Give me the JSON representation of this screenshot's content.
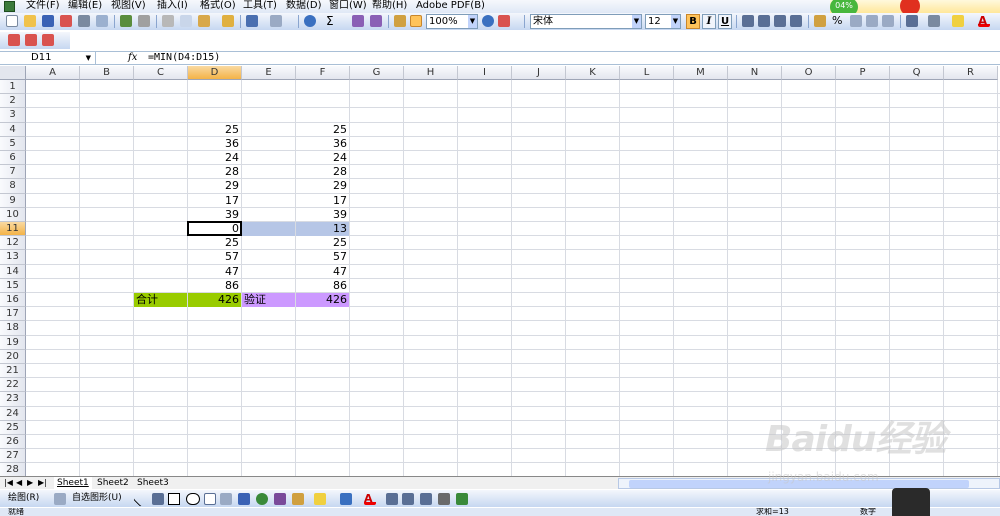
{
  "menubar": {
    "items": [
      "文件(F)",
      "编辑(E)",
      "视图(V)",
      "插入(I)",
      "格式(O)",
      "工具(T)",
      "数据(D)",
      "窗口(W)",
      "帮助(H)",
      "Adobe PDF(B)"
    ],
    "widget_badge": "04%"
  },
  "toolbar": {
    "zoom": "100%",
    "font_name": "宋体",
    "font_size": "12",
    "bold_label": "B",
    "italic_label": "I",
    "underline_label": "U",
    "percent_label": "%",
    "font_color_label": "A"
  },
  "formula_bar": {
    "name_box": "D11",
    "fx_label": "fx",
    "formula": "=MIN(D4:D15)"
  },
  "grid": {
    "columns": [
      "A",
      "B",
      "C",
      "D",
      "E",
      "F",
      "G",
      "H",
      "I",
      "J",
      "K",
      "L",
      "M",
      "N",
      "O",
      "P",
      "Q",
      "R"
    ],
    "active_column": "D",
    "active_row": "11",
    "rows": [
      "1",
      "2",
      "3",
      "4",
      "5",
      "6",
      "7",
      "8",
      "9",
      "10",
      "11",
      "12",
      "13",
      "14",
      "15",
      "16",
      "17",
      "18",
      "19",
      "20",
      "21",
      "22",
      "23",
      "24",
      "25",
      "26",
      "27",
      "28"
    ],
    "col_d_values": [
      "25",
      "36",
      "24",
      "28",
      "29",
      "17",
      "39",
      "0",
      "25",
      "57",
      "47",
      "86"
    ],
    "col_f_values": [
      "25",
      "36",
      "24",
      "28",
      "29",
      "17",
      "39",
      "13",
      "25",
      "57",
      "47",
      "86"
    ],
    "total_label": "合计",
    "total_value": "426",
    "verify_label": "验证",
    "verify_value": "426",
    "colors": {
      "total_fill": "#99cc00",
      "verify_fill": "#cc99ff",
      "selection_fill": "#b6c6e6"
    }
  },
  "sheet_tabs": {
    "tabs": [
      "Sheet1",
      "Sheet2",
      "Sheet3"
    ],
    "active": "Sheet1"
  },
  "drawing_toolbar": {
    "draw_label": "绘图(R)",
    "autoshapes_label": "自选图形(U)"
  },
  "status_bar": {
    "ready": "就绪",
    "sum_text": "求和=13",
    "num_text": "数字"
  },
  "watermark": {
    "brand": "Baidu经验",
    "url": "jingyan.baidu.com"
  }
}
